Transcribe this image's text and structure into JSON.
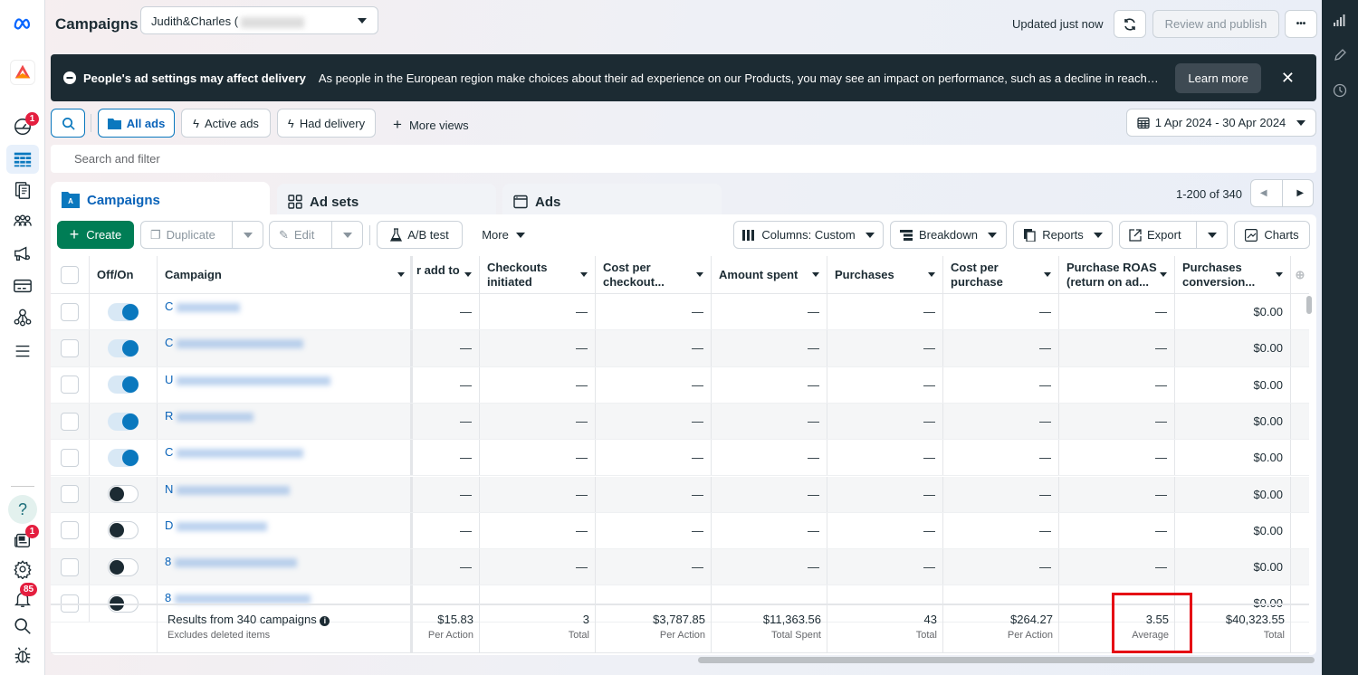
{
  "header": {
    "title": "Campaigns",
    "account_name": "Judith&Charles (",
    "updated_text": "Updated just now",
    "review_publish_label": "Review and publish",
    "more_label": "•••"
  },
  "left_nav": {
    "badges": {
      "notifications_top": "1",
      "news": "1",
      "alerts": "85"
    }
  },
  "banner": {
    "title": "People's ad settings may affect delivery",
    "message": "As people in the European region make choices about their ad experience on our Products, you may see an impact on performance, such as a decline in reach. In certain cases, your ad may not deliver.",
    "learn_more": "Learn more"
  },
  "views": {
    "all_ads": "All ads",
    "active_ads": "Active ads",
    "had_delivery": "Had delivery",
    "more_views": "More views",
    "date_range": "1 Apr 2024 - 30 Apr 2024"
  },
  "search": {
    "placeholder": "Search and filter"
  },
  "tabs": [
    {
      "label": "Campaigns"
    },
    {
      "label": "Ad sets"
    },
    {
      "label": "Ads"
    }
  ],
  "pagination": {
    "text": "1-200 of 340"
  },
  "toolbar": {
    "create": "Create",
    "duplicate": "Duplicate",
    "edit": "Edit",
    "ab_test": "A/B test",
    "more": "More",
    "columns": "Columns: Custom",
    "breakdown": "Breakdown",
    "reports": "Reports",
    "export": "Export",
    "charts": "Charts"
  },
  "table": {
    "columns": [
      "Off/On",
      "Campaign",
      "r add to",
      "Checkouts initiated",
      "Cost per checkout...",
      "Amount spent",
      "Purchases",
      "Cost per purchase",
      "Purchase ROAS (return on ad...",
      "Purchases conversion..."
    ],
    "rows": [
      {
        "on": true,
        "initial": "C",
        "values": [
          "—",
          "—",
          "—",
          "—",
          "—",
          "—",
          "—",
          "$0.00"
        ]
      },
      {
        "on": true,
        "initial": "C",
        "values": [
          "—",
          "—",
          "—",
          "—",
          "—",
          "—",
          "—",
          "$0.00"
        ]
      },
      {
        "on": true,
        "initial": "U",
        "values": [
          "—",
          "—",
          "—",
          "—",
          "—",
          "—",
          "—",
          "$0.00"
        ]
      },
      {
        "on": true,
        "initial": "R",
        "values": [
          "—",
          "—",
          "—",
          "—",
          "—",
          "—",
          "—",
          "$0.00"
        ]
      },
      {
        "on": true,
        "initial": "C",
        "values": [
          "—",
          "—",
          "—",
          "—",
          "—",
          "—",
          "—",
          "$0.00"
        ]
      },
      {
        "on": false,
        "initial": "N",
        "values": [
          "—",
          "—",
          "—",
          "—",
          "—",
          "—",
          "—",
          "$0.00"
        ]
      },
      {
        "on": false,
        "initial": "D",
        "values": [
          "—",
          "—",
          "—",
          "—",
          "—",
          "—",
          "—",
          "$0.00"
        ]
      },
      {
        "on": false,
        "initial": "8",
        "values": [
          "—",
          "—",
          "—",
          "—",
          "—",
          "—",
          "—",
          "$0.00"
        ]
      },
      {
        "on": false,
        "initial": "8",
        "values": [
          "—",
          "—",
          "—",
          "—",
          "—",
          "—",
          "—",
          "$0.00"
        ]
      }
    ],
    "summary": {
      "title": "Results from 340 campaigns",
      "subtitle": "Excludes deleted items",
      "cells": [
        {
          "value": "$15.83",
          "label": "Per Action"
        },
        {
          "value": "3",
          "label": "Total"
        },
        {
          "value": "$3,787.85",
          "label": "Per Action"
        },
        {
          "value": "$11,363.56",
          "label": "Total Spent"
        },
        {
          "value": "43",
          "label": "Total"
        },
        {
          "value": "$264.27",
          "label": "Per Action"
        },
        {
          "value": "3.55",
          "label": "Average"
        },
        {
          "value": "$40,323.55",
          "label": "Total"
        }
      ]
    }
  },
  "colors": {
    "accent": "#0a78be",
    "create": "#007d55",
    "banner": "#1c2b33",
    "highlight": "#e50914"
  }
}
